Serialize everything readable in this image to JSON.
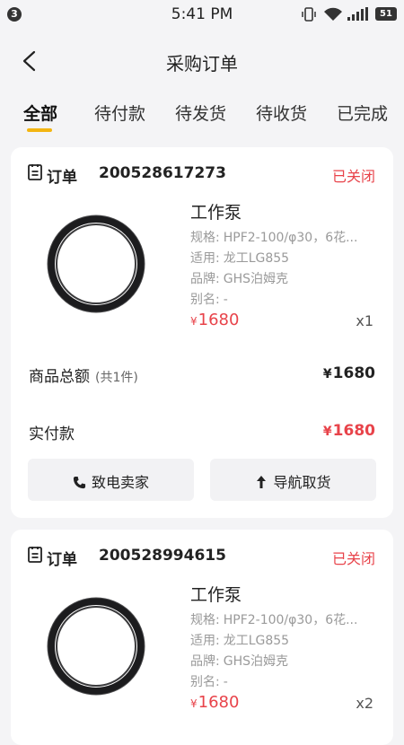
{
  "status_bar": {
    "notification_count": "3",
    "time": "5:41 PM",
    "battery": "51"
  },
  "header": {
    "title": "采购订单"
  },
  "tabs": [
    {
      "label": "全部",
      "active": true
    },
    {
      "label": "待付款"
    },
    {
      "label": "待发货"
    },
    {
      "label": "待收货"
    },
    {
      "label": "已完成"
    }
  ],
  "orders": [
    {
      "label": "订单",
      "order_no": "200528617273",
      "status": "已关闭",
      "product": {
        "name": "工作泵",
        "spec_label": "规格:",
        "spec_value": "HPF2-100/φ30，6花...",
        "fit_label": "适用:",
        "fit_value": "龙工LG855",
        "brand_label": "品牌:",
        "brand_value": "GHS泊姆克",
        "alias_label": "别名:",
        "alias_value": "-",
        "currency": "¥",
        "price": "1680",
        "qty": "x1"
      },
      "total_label": "商品总额",
      "total_count": "(共1件)",
      "total_currency": "¥",
      "total_amount": "1680",
      "paid_label": "实付款",
      "paid_currency": "¥",
      "paid_amount": "1680",
      "call_button": "致电卖家",
      "nav_button": "导航取货"
    },
    {
      "label": "订单",
      "order_no": "200528994615",
      "status": "已关闭",
      "product": {
        "name": "工作泵",
        "spec_label": "规格:",
        "spec_value": "HPF2-100/φ30，6花...",
        "fit_label": "适用:",
        "fit_value": "龙工LG855",
        "brand_label": "品牌:",
        "brand_value": "GHS泊姆克",
        "alias_label": "别名:",
        "alias_value": "-",
        "currency": "¥",
        "price": "1680",
        "qty": "x2"
      }
    }
  ],
  "colors": {
    "accent": "#f3b511",
    "status_closed": "#e8434a",
    "background": "#f4f4f6"
  },
  "icons": [
    "back-icon",
    "order-icon",
    "phone-icon",
    "navigate-icon",
    "vibrate-icon",
    "wifi-icon",
    "signal-icon",
    "battery-icon"
  ]
}
